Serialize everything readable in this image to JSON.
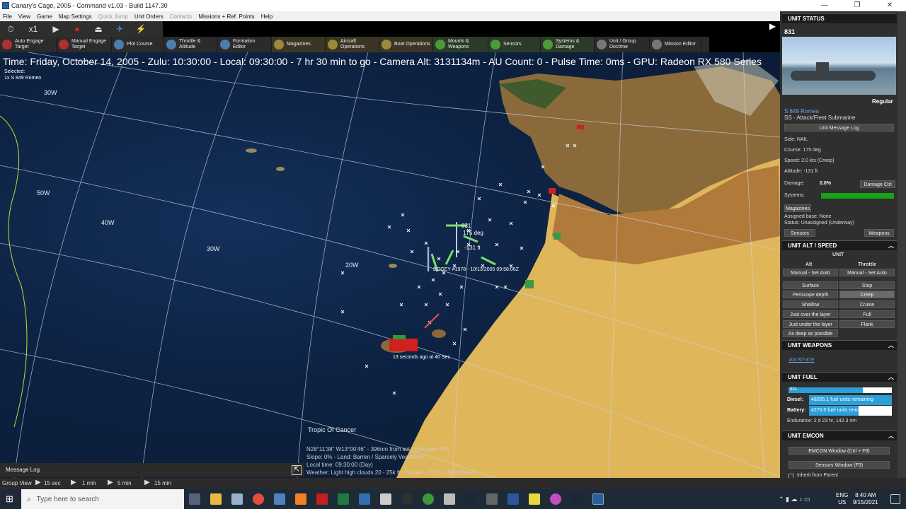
{
  "window": {
    "title": "Canary's Cage, 2005 - Command v1.03 - Build 1147.30",
    "minimize": "—",
    "restore": "❐",
    "close": "✕"
  },
  "menu": [
    "File",
    "View",
    "Game",
    "Map Settings",
    "Quick Jump",
    "Unit Orders",
    "Contacts",
    "Missions + Ref. Points",
    "Help"
  ],
  "menu_dim": [
    false,
    false,
    false,
    false,
    true,
    false,
    true,
    false,
    false
  ],
  "toolbar": {
    "speed": "x1"
  },
  "tabs": [
    {
      "label": "Auto Engage Target",
      "color": "#b03030"
    },
    {
      "label": "Manual Engage Target",
      "color": "#b03030"
    },
    {
      "label": "Plot Course",
      "color": "#4a7db0"
    },
    {
      "label": "Throttle & Altitude",
      "color": "#4a7db0"
    },
    {
      "label": "Formation Editor",
      "color": "#4a7db0"
    },
    {
      "label": "Magazines",
      "color": "#9a8a3a"
    },
    {
      "label": "Aircraft Operations",
      "color": "#9a8a3a"
    },
    {
      "label": "Boat Operations",
      "color": "#9a8a3a"
    },
    {
      "label": "Mounts & Weapons",
      "color": "#4d9a3a"
    },
    {
      "label": "Sensors",
      "color": "#4d9a3a"
    },
    {
      "label": "Systems & Damage",
      "color": "#4d9a3a"
    },
    {
      "label": "Unit / Group Doctrine",
      "color": "#777"
    },
    {
      "label": "Mission Editor",
      "color": "#777"
    }
  ],
  "status_line": "Time: Friday, October 14, 2005 - Zulu: 10:30:00 - Local: 09:30:00 - 7 hr 30 min to go  -  Camera Alt: 3131134m  - AU Count: 0 - Pulse Time: 0ms - GPU: Radeon RX 580 Series",
  "selected": {
    "label": "Selected:",
    "unit": "1x S 849 Romeo"
  },
  "map_labels": {
    "lon_30w_top": "30W",
    "lon_40w": "40W",
    "lon_50w": "50W",
    "lon_30w": "30W",
    "lon_20w": "20W",
    "tropic": "Tropic Of Cancer",
    "unit_id": "831",
    "unit_course": "175 deg",
    "unit_alt": "-131 ft",
    "contact_label": "BOGEY #1978 - 10/13/2005 09:58:06Z",
    "island_label": "13 seconds ago at 40 Sec"
  },
  "readout": {
    "line1": "N28°11'38\"  W13°00'46\" - 396nm from sel - Elevation 67ft",
    "line2": "Slope: 0% - Land: Barren / Sparsely Vegetated",
    "line3": "Local time: 09:30:00 (Day)",
    "line4": "Weather: Light high clouds 20 - 25k ft - No rain - 20°C - Wind/Sea 2"
  },
  "message_log": "Message Log",
  "group_view": {
    "label": "Group View",
    "steps": [
      "15 sec",
      "1 min",
      "5 min",
      "15 min"
    ]
  },
  "panel": {
    "unit_status": "UNIT STATUS",
    "unit_id": "831",
    "proficiency": "Regular",
    "class": "S 849 Romeo",
    "type": "SS - Attack/Fleet Submarine",
    "msg_log_btn": "Unit Message Log",
    "side": "Side: NAIL",
    "course": "Course: 175 deg",
    "speed": "Speed: 2.0 kts (Creep)",
    "altitude": "Altitude: -131 ft",
    "damage_label": "Damage:",
    "damage_value": "0.0%",
    "damage_ctrl": "Damage Ctrl",
    "systems_label": "Systems:",
    "magazines_btn": "Magazines",
    "assigned_base": "Assigned base: None",
    "status": "Status: Unassigned (Underway)",
    "sensors_btn": "Sensors",
    "weapons_btn": "Weapons",
    "alt_speed_hdr": "UNIT ALT / SPEED",
    "unit_label": "UNIT",
    "alt_col": "Alt",
    "throttle_col": "Throttle",
    "alt_buttons": [
      "Manual - Set Auto",
      "Surface",
      "Periscope depth",
      "Shallow",
      "Just over the layer",
      "Just under the layer",
      "As deep as possible"
    ],
    "throttle_buttons": [
      "Manual - Set Auto",
      "Stop",
      "Creep",
      "Cruise",
      "Full",
      "Flank"
    ],
    "weapons_hdr": "UNIT WEAPONS",
    "weapon_item": "10x NT-37F",
    "fuel_hdr": "UNIT FUEL",
    "fuel_unit": "831",
    "diesel_label": "Diesel:",
    "diesel_value": "48355.1 fuel units remaining",
    "battery_label": "Battery:",
    "battery_value": "4270.0 fuel units remaining",
    "endurance": "Endurance: 2 d 23 hr, 142.3 nm",
    "emcon_hdr": "UNIT EMCON",
    "emcon_btn": "EMCON Window (Ctrl + F9)",
    "sensors_window_btn": "Sensors Window (F9)",
    "inherit": "Inherit from Parent"
  },
  "taskbar": {
    "search_placeholder": "Type here to search",
    "lang1": "ENG",
    "lang2": "US",
    "time": "8:40 AM",
    "date": "9/15/2021"
  }
}
